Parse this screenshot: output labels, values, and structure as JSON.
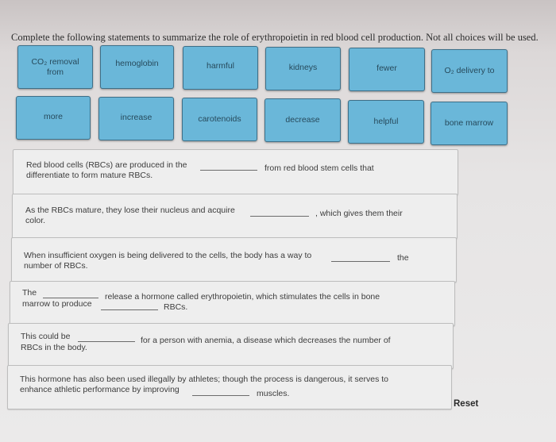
{
  "instructions": "Complete the following statements to summarize the role of erythropoietin in red blood cell production. Not all choices will be used.",
  "choices": [
    "CO₂ removal from",
    "hemoglobin",
    "harmful",
    "kidneys",
    "fewer",
    "O₂ delivery to",
    "more",
    "increase",
    "carotenoids",
    "decrease",
    "helpful",
    "bone marrow"
  ],
  "choice_lines": {
    "co2_line1": "CO₂ removal",
    "co2_line2": "from"
  },
  "statements": [
    {
      "before": "Red blood cells (RBCs) are produced in the",
      "after": "from red blood stem cells that",
      "line2": "differentiate to form mature RBCs."
    },
    {
      "before": "As the RBCs mature, they lose their nucleus and acquire",
      "after": ", which gives them their",
      "line2": "color."
    },
    {
      "before": "When insufficient oxygen is being delivered to the cells, the body has a way to",
      "after": "the",
      "line2": "number of RBCs."
    },
    {
      "before": "The",
      "after": "release a hormone called erythropoietin, which stimulates the cells in bone",
      "line2_before": "marrow to produce",
      "line2_after": "RBCs."
    },
    {
      "before": "This could be",
      "after": "for a person with anemia, a disease which decreases the number of",
      "line2": "RBCs in the body."
    },
    {
      "line1": "This hormone has also been used illegally by athletes; though the process is dangerous, it serves to",
      "before": "enhance athletic performance by improving",
      "after": "muscles."
    }
  ],
  "reset_label": "Reset",
  "colors": {
    "chip_fill": "#6ab7d9",
    "chip_border": "#3e6f88",
    "statement_bg": "#eeeeee"
  }
}
